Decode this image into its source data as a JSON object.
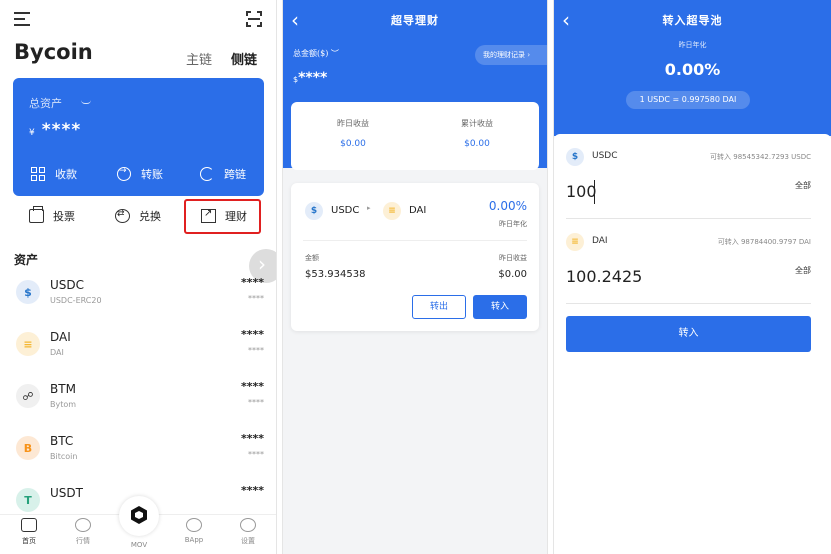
{
  "screen1": {
    "app_title": "Bycoin",
    "chain_tabs": [
      "主链",
      "侧链"
    ],
    "total_assets_label": "总资产",
    "total_assets_currency": "¥",
    "total_assets_value": "****",
    "card_actions": [
      "收款",
      "转账",
      "跨链"
    ],
    "sub_actions": [
      "投票",
      "兑换",
      "理财"
    ],
    "assets_section_title": "资产",
    "tokens": [
      {
        "name": "USDC",
        "sub": "USDC-ERC20",
        "bal": "****",
        "bal2": "****",
        "icon": "$",
        "icon_bg": "#e3ecf9",
        "icon_color": "#2775ca"
      },
      {
        "name": "DAI",
        "sub": "DAI",
        "bal": "****",
        "bal2": "****",
        "icon": "≡",
        "icon_bg": "#fdf0d6",
        "icon_color": "#f4b731"
      },
      {
        "name": "BTM",
        "sub": "Bytom",
        "bal": "****",
        "bal2": "****",
        "icon": "☍",
        "icon_bg": "#f0f0f0",
        "icon_color": "#333333"
      },
      {
        "name": "BTC",
        "sub": "Bitcoin",
        "bal": "****",
        "bal2": "****",
        "icon": "B",
        "icon_bg": "#fde8d4",
        "icon_color": "#f7931a"
      },
      {
        "name": "USDT",
        "sub": "",
        "bal": "****",
        "bal2": "",
        "icon": "T",
        "icon_bg": "#d8f1ea",
        "icon_color": "#26a17b"
      }
    ],
    "nav": [
      "首页",
      "行情",
      "MOV",
      "BApp",
      "设置"
    ]
  },
  "screen2": {
    "title": "超导理财",
    "total_label": "总金额($)",
    "total_currency": "$",
    "total_value": "****",
    "record_button": "我的理财记录",
    "yesterday_income_label": "昨日收益",
    "yesterday_income": "$0.00",
    "cumulative_income_label": "累计收益",
    "cumulative_income": "$0.00",
    "pair_from": "USDC",
    "pair_to": "DAI",
    "rate": "0.00%",
    "rate_label": "昨日年化",
    "amount_label": "金额",
    "amount_value": "$53.934538",
    "product_yesterday_label": "昨日收益",
    "product_yesterday_value": "$0.00",
    "btn_out": "转出",
    "btn_in": "转入"
  },
  "screen3": {
    "title": "转入超导池",
    "rate_label": "昨日年化",
    "rate": "0.00%",
    "exchange_rate": "1 USDC = 0.997580 DAI",
    "usdc_label": "USDC",
    "usdc_available": "可转入 98545342.7293 USDC",
    "usdc_amount": "100",
    "all_label": "全部",
    "dai_label": "DAI",
    "dai_available": "可转入 98784400.9797 DAI",
    "dai_amount": "100.2425",
    "confirm_button": "转入"
  },
  "colors": {
    "accent": "#2b6ee8",
    "highlight": "#e02020"
  }
}
